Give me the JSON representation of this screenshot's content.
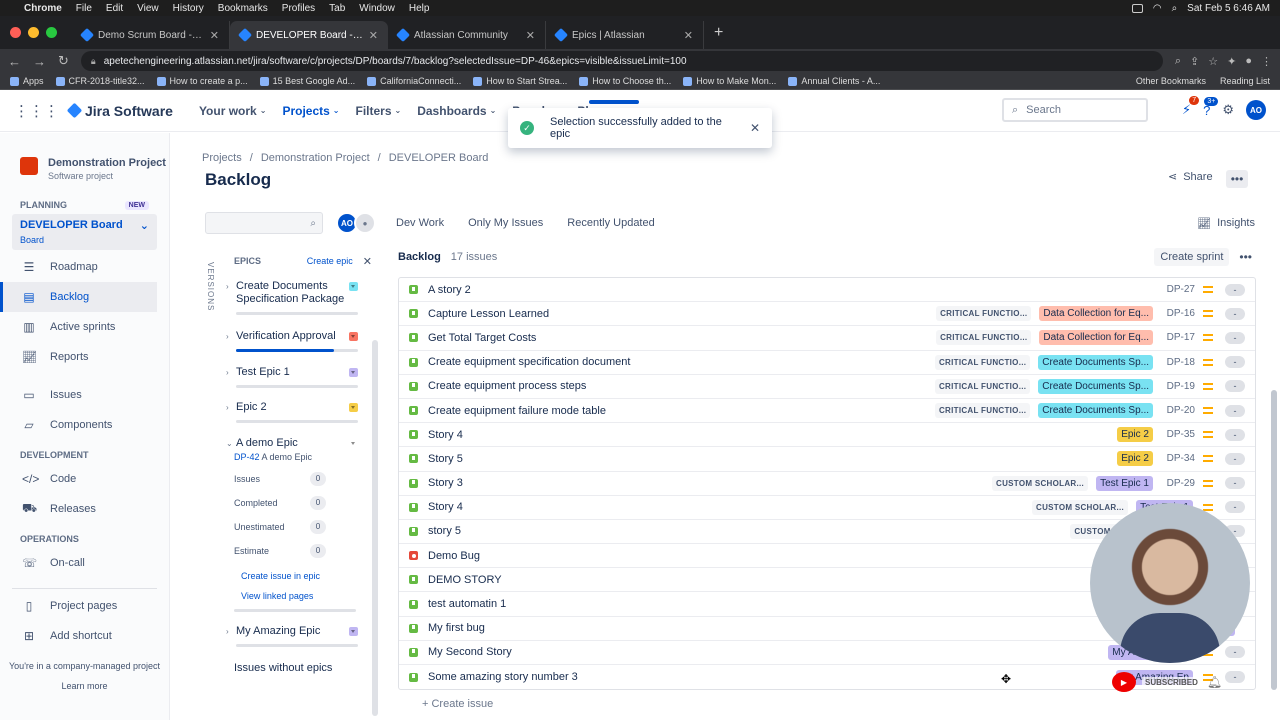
{
  "macbar": {
    "menus": [
      "Chrome",
      "File",
      "Edit",
      "View",
      "History",
      "Bookmarks",
      "Profiles",
      "Tab",
      "Window",
      "Help"
    ],
    "clock": "Sat Feb 5  6:46 AM"
  },
  "browser": {
    "tabs": [
      {
        "title": "Demo Scrum Board - Roadmap",
        "active": false
      },
      {
        "title": "DEVELOPER Board - Agile Boa",
        "active": true
      },
      {
        "title": "Atlassian Community",
        "active": false
      },
      {
        "title": "Epics | Atlassian",
        "active": false
      }
    ],
    "url": "apetechengineering.atlassian.net/jira/software/c/projects/DP/boards/7/backlog?selectedIssue=DP-46&epics=visible&issueLimit=100",
    "bookmarks": [
      "Apps",
      "CFR-2018-title32...",
      "How to create a p...",
      "15 Best Google Ad...",
      "CaliforniaConnecti...",
      "How to Start Strea...",
      "How to Choose th...",
      "How to Make Mon...",
      "Annual Clients - A..."
    ],
    "bookmarks_right": [
      "Other Bookmarks",
      "Reading List"
    ]
  },
  "jira_nav": {
    "product": "Jira Software",
    "links": [
      {
        "label": "Your work",
        "active": false
      },
      {
        "label": "Projects",
        "active": true
      },
      {
        "label": "Filters",
        "active": false
      },
      {
        "label": "Dashboards",
        "active": false
      },
      {
        "label": "People",
        "active": false
      },
      {
        "label": "Plan",
        "active": false
      }
    ],
    "search_placeholder": "Search",
    "notif_count": "7",
    "help_count": "3+",
    "avatar": "AO"
  },
  "toast": {
    "message": "Selection successfully added to the epic"
  },
  "sidebar": {
    "project_name": "Demonstration Project",
    "project_type": "Software project",
    "planning_label": "PLANNING",
    "new_badge": "NEW",
    "board_name": "DEVELOPER Board",
    "board_sub": "Board",
    "planning_items": [
      {
        "label": "Roadmap",
        "icon": "roadmap-icon",
        "active": false
      },
      {
        "label": "Backlog",
        "icon": "backlog-icon",
        "active": true
      },
      {
        "label": "Active sprints",
        "icon": "active-sprints-icon",
        "active": false
      },
      {
        "label": "Reports",
        "icon": "reports-icon",
        "active": false
      }
    ],
    "other_items": [
      {
        "label": "Issues",
        "icon": "issues-icon"
      },
      {
        "label": "Components",
        "icon": "components-icon"
      }
    ],
    "development_label": "DEVELOPMENT",
    "dev_items": [
      {
        "label": "Code",
        "icon": "code-icon"
      },
      {
        "label": "Releases",
        "icon": "releases-icon"
      }
    ],
    "operations_label": "OPERATIONS",
    "ops_items": [
      {
        "label": "On-call",
        "icon": "on-call-icon"
      }
    ],
    "footer_items": [
      {
        "label": "Project pages",
        "icon": "project-pages-icon"
      },
      {
        "label": "Add shortcut",
        "icon": "add-shortcut-icon"
      }
    ],
    "managed_note": "You're in a company-managed project",
    "learn_more": "Learn more"
  },
  "page": {
    "breadcrumb": [
      "Projects",
      "Demonstration Project",
      "DEVELOPER Board"
    ],
    "title": "Backlog",
    "share": "Share",
    "insights": "Insights",
    "quick_filters": [
      "Dev Work",
      "Only My Issues",
      "Recently Updated"
    ],
    "avatar": "AO"
  },
  "epics_panel": {
    "versions_tab": "VERSIONS",
    "title": "EPICS",
    "create_epic": "Create epic",
    "epics": [
      {
        "name": "Create Documents Specification Package",
        "color": "#79e2f2",
        "progress": 0
      },
      {
        "name": "Verification Approval",
        "color": "#f87462",
        "progress": 0.8
      },
      {
        "name": "Test Epic 1",
        "color": "#c0b6f2",
        "progress": 0
      },
      {
        "name": "Epic 2",
        "color": "#f5cd47",
        "progress": 0
      },
      {
        "name": "A demo Epic",
        "color": "#ffffff",
        "progress": 0
      },
      {
        "name": "My Amazing Epic",
        "color": "#c0b6f2",
        "progress": 0
      }
    ],
    "demo_epic": {
      "key": "DP-42",
      "name": "A demo Epic",
      "stats": [
        {
          "label": "Issues",
          "value": "0"
        },
        {
          "label": "Completed",
          "value": "0"
        },
        {
          "label": "Unestimated",
          "value": "0"
        },
        {
          "label": "Estimate",
          "value": "0"
        }
      ],
      "create_link": "Create issue in epic",
      "linked_pages": "View linked pages"
    },
    "issues_without_epics": "Issues without epics"
  },
  "backlog": {
    "title": "Backlog",
    "count": "17 issues",
    "create_sprint": "Create sprint",
    "create_issue": "+ Create issue",
    "issues": [
      {
        "type": "story",
        "summary": "A story 2",
        "label": "",
        "epic": "",
        "epic_bg": "",
        "key": "DP-27",
        "est": "-"
      },
      {
        "type": "story",
        "summary": "Capture Lesson Learned",
        "label": "CRITICAL FUNCTIO...",
        "epic": "Data Collection for Eq...",
        "epic_bg": "#ffbdad",
        "key": "DP-16",
        "est": "-"
      },
      {
        "type": "story",
        "summary": "Get Total Target Costs",
        "label": "CRITICAL FUNCTIO...",
        "epic": "Data Collection for Eq...",
        "epic_bg": "#ffbdad",
        "key": "DP-17",
        "est": "-"
      },
      {
        "type": "story",
        "summary": "Create equipment specification document",
        "label": "CRITICAL FUNCTIO...",
        "epic": "Create Documents Sp...",
        "epic_bg": "#79e2f2",
        "key": "DP-18",
        "est": "-"
      },
      {
        "type": "story",
        "summary": "Create equipment process steps",
        "label": "CRITICAL FUNCTIO...",
        "epic": "Create Documents Sp...",
        "epic_bg": "#79e2f2",
        "key": "DP-19",
        "est": "-"
      },
      {
        "type": "story",
        "summary": "Create equipment failure mode table",
        "label": "CRITICAL FUNCTIO...",
        "epic": "Create Documents Sp...",
        "epic_bg": "#79e2f2",
        "key": "DP-20",
        "est": "-"
      },
      {
        "type": "story",
        "summary": "Story 4",
        "label": "",
        "epic": "Epic 2",
        "epic_bg": "#f5cd47",
        "key": "DP-35",
        "est": "-"
      },
      {
        "type": "story",
        "summary": "Story 5",
        "label": "",
        "epic": "Epic 2",
        "epic_bg": "#f5cd47",
        "key": "DP-34",
        "est": "-"
      },
      {
        "type": "story",
        "summary": "Story 3",
        "label": "CUSTOM SCHOLAR...",
        "epic": "Test Epic 1",
        "epic_bg": "#c0b6f2",
        "key": "DP-29",
        "est": "-"
      },
      {
        "type": "story",
        "summary": "Story 4",
        "label": "CUSTOM SCHOLAR...",
        "epic": "Test Epic 1",
        "epic_bg": "#c0b6f2",
        "key": "",
        "est": "-"
      },
      {
        "type": "story",
        "summary": "story 5",
        "label": "CUSTOM SCHOLAR...",
        "epic": "Te",
        "epic_bg": "#c0b6f2",
        "key": "",
        "est": "-"
      },
      {
        "type": "bug",
        "summary": "Demo Bug",
        "label": "",
        "epic": "",
        "epic_bg": "",
        "key": "",
        "est": ""
      },
      {
        "type": "story",
        "summary": "DEMO STORY",
        "label": "",
        "epic": "",
        "epic_bg": "",
        "key": "",
        "est": ""
      },
      {
        "type": "story",
        "summary": "test automatin 1",
        "label": "",
        "epic": "",
        "epic_bg": "",
        "key": "",
        "est": ""
      },
      {
        "type": "story",
        "summary": "My first bug",
        "label": "",
        "epic": "My Amazing",
        "epic_bg": "#c0b6f2",
        "key": "",
        "est": ""
      },
      {
        "type": "story",
        "summary": "My Second Story",
        "label": "",
        "epic": "My Amazing Epic",
        "epic_bg": "#c0b6f2",
        "key": "",
        "est": "-"
      },
      {
        "type": "story",
        "summary": "Some amazing story number 3",
        "label": "",
        "epic": "My Amazing Ep",
        "epic_bg": "#c0b6f2",
        "key": "",
        "est": "-"
      }
    ]
  },
  "overlay": {
    "subscribed": "SUBSCRIBED"
  }
}
